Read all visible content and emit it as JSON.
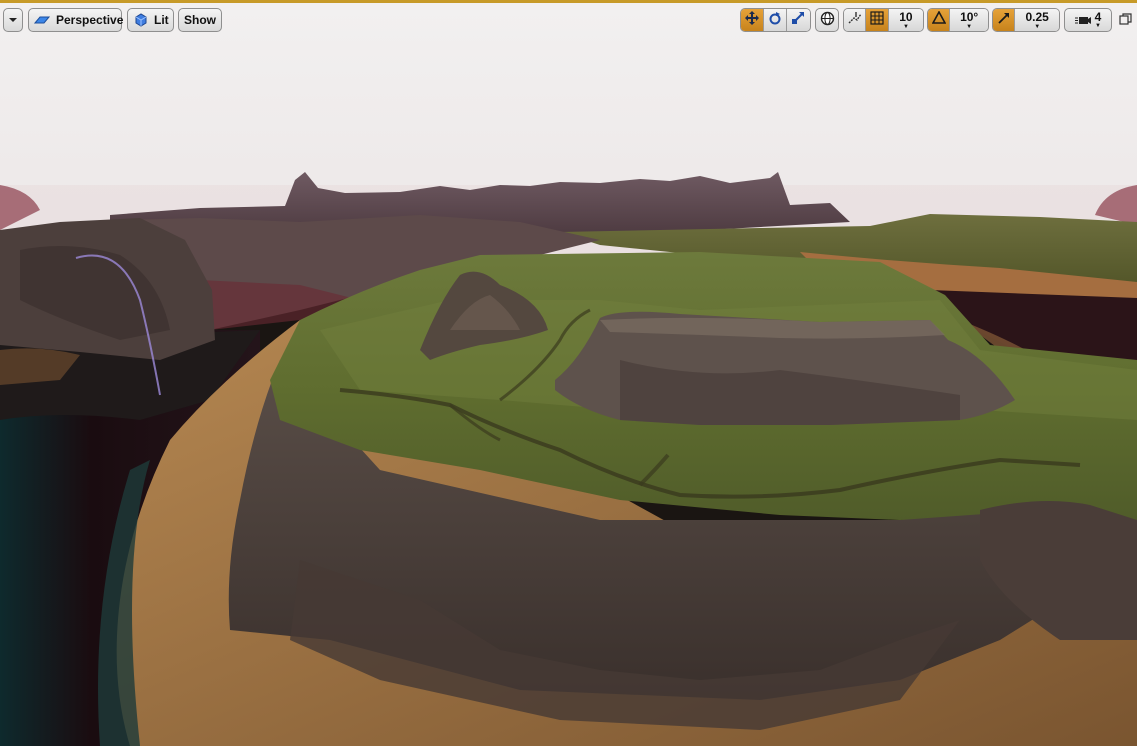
{
  "toolbar": {
    "menu_icon": "chevron-down-icon",
    "perspective_label": "Perspective",
    "lit_label": "Lit",
    "show_label": "Show",
    "grid_snap_value": "10",
    "rotation_snap_value": "10°",
    "scale_snap_value": "0.25",
    "camera_speed_value": "4",
    "accent_color": "#d08a22"
  },
  "viewport": {
    "scene": "3D landscape: grassy plateau with rocky cliffs, sandy shore, dark water, distant mountain ridge"
  }
}
